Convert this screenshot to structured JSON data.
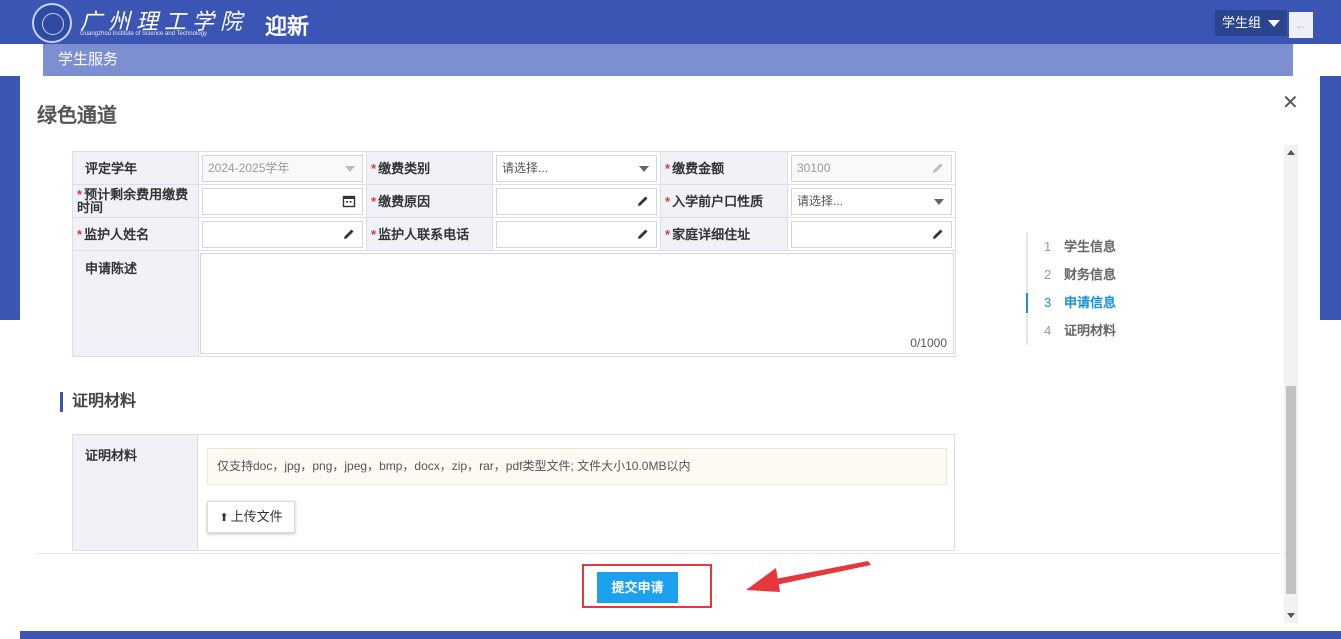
{
  "header": {
    "school_name": "广州理工学院",
    "school_subtitle": "Guangzhou Institute of Science and Technology",
    "app_title": "迎新",
    "role": "学生组"
  },
  "subnav": {
    "label": "学生服务"
  },
  "modal": {
    "title": "绿色通道",
    "form": {
      "year_label": "评定学年",
      "year_value": "2024-2025学年",
      "category_label": "缴费类别",
      "category_placeholder": "请选择...",
      "amount_label": "缴费金额",
      "amount_value": "30100",
      "due_label": "预计剩余费用缴费时间",
      "reason_label": "缴费原因",
      "hukou_label": "入学前户口性质",
      "hukou_placeholder": "请选择...",
      "guardian_label": "监护人姓名",
      "guardian_phone_label": "监护人联系电话",
      "address_label": "家庭详细住址",
      "statement_label": "申请陈述",
      "statement_count": "0/1000"
    },
    "materials": {
      "section_title": "证明材料",
      "label": "证明材料",
      "notice": "仅支持doc，jpg，png，jpeg，bmp，docx，zip，rar，pdf类型文件; 文件大小10.0MB以内",
      "upload_label": "上传文件"
    },
    "steps": [
      {
        "num": "1",
        "label": "学生信息"
      },
      {
        "num": "2",
        "label": "财务信息"
      },
      {
        "num": "3",
        "label": "申请信息"
      },
      {
        "num": "4",
        "label": "证明材料"
      }
    ],
    "active_step": 3,
    "submit_label": "提交申请"
  },
  "colors": {
    "brand_blue": "#3a55b3",
    "active_step": "#1a90d9",
    "submit": "#1aa0ec",
    "annotation_red": "#e6383c",
    "required_star": "#e0393e"
  }
}
